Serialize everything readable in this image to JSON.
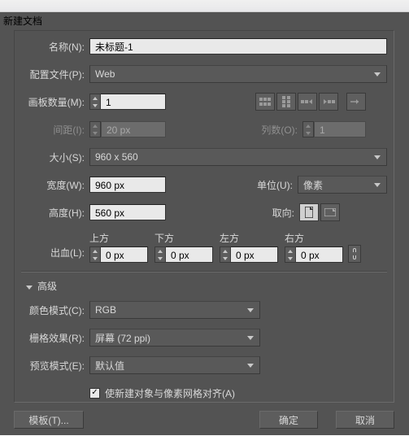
{
  "window": {
    "title": "新建文档"
  },
  "labels": {
    "name": "名称(N):",
    "profile": "配置文件(P):",
    "artboards": "画板数量(M):",
    "spacing": "间距(I):",
    "columns": "列数(O):",
    "size": "大小(S):",
    "width": "宽度(W):",
    "units": "单位(U):",
    "height": "高度(H):",
    "orientation": "取向:",
    "bleed": "出血(L):",
    "advanced": "高级",
    "colormode": "颜色模式(C):",
    "raster": "栅格效果(R):",
    "preview": "预览模式(E):",
    "alignpixel": "使新建对象与像素网格对齐(A)",
    "template": "模板(T)...",
    "ok": "确定",
    "cancel": "取消",
    "top": "上方",
    "bottom": "下方",
    "left": "左方",
    "right": "右方"
  },
  "values": {
    "name": "未标题-1",
    "profile": "Web",
    "artboards": "1",
    "spacing": "20 px",
    "columns": "1",
    "size": "960 x 560",
    "width": "960 px",
    "units": "像素",
    "height": "560 px",
    "bleed_top": "0 px",
    "bleed_bottom": "0 px",
    "bleed_left": "0 px",
    "bleed_right": "0 px",
    "colormode": "RGB",
    "raster": "屏幕 (72 ppi)",
    "preview": "默认值",
    "alignpixel_checked": true
  }
}
